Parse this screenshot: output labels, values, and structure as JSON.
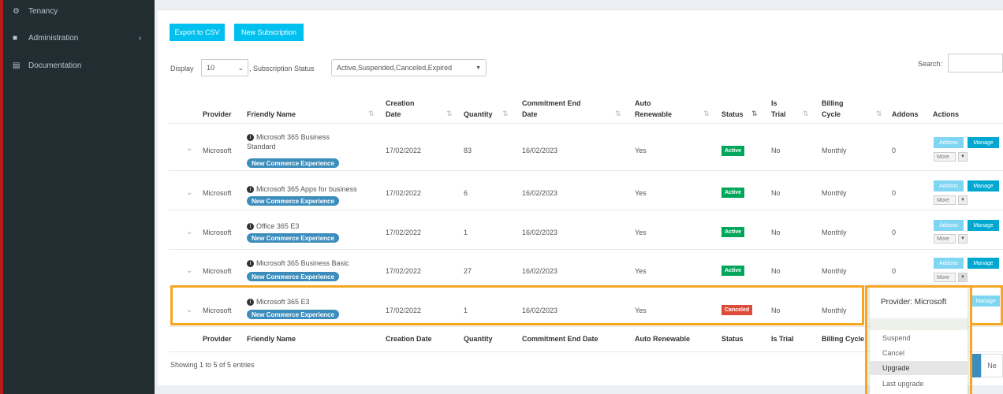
{
  "sidebar": {
    "items": [
      {
        "label": "Tenancy",
        "icon": "gear-icon"
      },
      {
        "label": "Administration",
        "icon": "briefcase-icon"
      },
      {
        "label": "Documentation",
        "icon": "book-icon"
      }
    ]
  },
  "toolbar": {
    "export_label": "Export to CSV",
    "new_subscription_label": "New Subscription"
  },
  "filters": {
    "display_label": "Display",
    "display_value": "10",
    "status_label": ", Subscription Status",
    "status_value": "Active,Suspended,Canceled,Expired",
    "search_label": "Search:"
  },
  "table": {
    "headers": {
      "provider": "Provider",
      "friendly_name": "Friendly Name",
      "creation_date_1": "Creation",
      "creation_date_2": "Date",
      "quantity": "Quantity",
      "commitment_1": "Commitment End",
      "commitment_2": "Date",
      "auto_1": "Auto",
      "auto_2": "Renewable",
      "status": "Status",
      "trial_1": "Is",
      "trial_2": "Trial",
      "billing_1": "Billing",
      "billing_2": "Cycle",
      "addons": "Addons",
      "actions": "Actions"
    },
    "footer": {
      "provider": "Provider",
      "friendly_name": "Friendly Name",
      "creation_date": "Creation Date",
      "quantity": "Quantity",
      "commitment": "Commitment End Date",
      "auto": "Auto Renewable",
      "status": "Status",
      "trial": "Is Trial",
      "billing": "Billing Cycle"
    },
    "badge": "New Commerce Experience",
    "addons_btn": "Addons",
    "manage_btn": "Manage",
    "more_btn": "More",
    "rows": [
      {
        "provider": "Microsoft",
        "name_1": "Microsoft 365 Business",
        "name_2": "Standard",
        "creation": "17/02/2022",
        "quantity": "83",
        "commitment": "16/02/2023",
        "auto": "Yes",
        "status": "Active",
        "trial": "No",
        "billing": "Monthly",
        "addons": "0"
      },
      {
        "provider": "Microsoft",
        "name_1": "Microsoft 365 Apps for business",
        "name_2": "",
        "creation": "17/02/2022",
        "quantity": "6",
        "commitment": "16/02/2023",
        "auto": "Yes",
        "status": "Active",
        "trial": "No",
        "billing": "Monthly",
        "addons": "0"
      },
      {
        "provider": "Microsoft",
        "name_1": "Office 365 E3",
        "name_2": "",
        "creation": "17/02/2022",
        "quantity": "1",
        "commitment": "16/02/2023",
        "auto": "Yes",
        "status": "Active",
        "trial": "No",
        "billing": "Monthly",
        "addons": "0"
      },
      {
        "provider": "Microsoft",
        "name_1": "Microsoft 365 Business Basic",
        "name_2": "",
        "creation": "17/02/2022",
        "quantity": "27",
        "commitment": "16/02/2023",
        "auto": "Yes",
        "status": "Active",
        "trial": "No",
        "billing": "Monthly",
        "addons": "0"
      },
      {
        "provider": "Microsoft",
        "name_1": "Microsoft 365 E3",
        "name_2": "",
        "creation": "17/02/2022",
        "quantity": "1",
        "commitment": "16/02/2023",
        "auto": "Yes",
        "status": "Canceled",
        "trial": "No",
        "billing": "Monthly",
        "addons": ""
      }
    ],
    "showing": "Showing 1 to 5 of 5 entries"
  },
  "dropdown": {
    "header": "Provider: Microsoft",
    "items": [
      "Suspend",
      "Cancel",
      "Upgrade",
      "Last upgrade"
    ]
  },
  "pager": {
    "next_label": "Ne"
  },
  "colors": {
    "sidebar": "#222d32",
    "accent": "#00c0ef",
    "active": "#00a65a",
    "canceled": "#dd4b39",
    "badge": "#3c8dbc",
    "highlight": "#f5a623"
  }
}
